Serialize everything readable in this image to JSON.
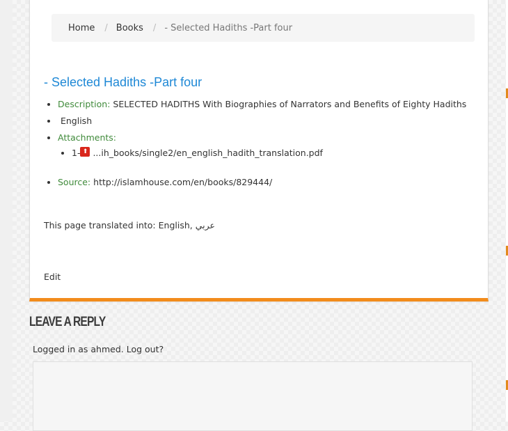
{
  "breadcrumb": {
    "home": "Home",
    "sep1": "/",
    "books": "Books",
    "sep2": "/",
    "current": "- Selected Hadiths -Part four"
  },
  "post": {
    "title": "- Selected Hadiths -Part four",
    "description_label": "Description:",
    "description_value": "SELECTED HADITHS With Biographies of Narrators and Benefits of Eighty Hadiths",
    "language": "English",
    "attachments_label": "Attachments:",
    "attachments": [
      {
        "index": "1-",
        "icon": "pdf-icon",
        "name": "...ih_books/single2/en_english_hadith_translation.pdf"
      }
    ],
    "source_label": "Source:",
    "source_url": "http://islamhouse.com/en/books/829444/",
    "translated_prefix": "This page translated into:",
    "translated_english": "English,",
    "translated_arabic": "عربي",
    "edit": "Edit"
  },
  "reply": {
    "title": "Leave a Reply",
    "logged_prefix": "Logged in as",
    "user": "ahmed",
    "logout": "Log out?"
  },
  "colors": {
    "accent": "#f28c1c",
    "title_blue": "#1e88d6",
    "label_green": "#3f8a3a"
  }
}
